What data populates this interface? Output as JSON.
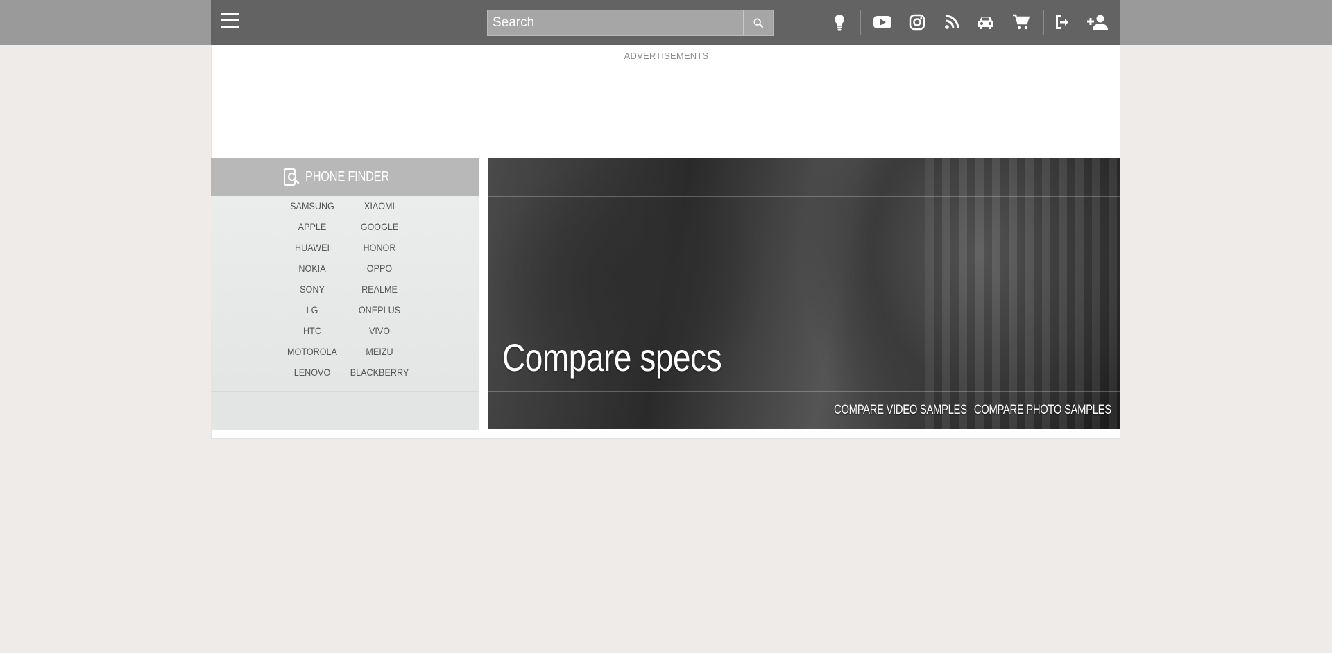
{
  "header": {
    "search_placeholder": "Search",
    "icons": [
      "menu-icon",
      "search-icon",
      "lightbulb-icon",
      "youtube-icon",
      "instagram-icon",
      "rss-icon",
      "car-icon",
      "cart-icon",
      "login-icon",
      "add-user-icon"
    ]
  },
  "ads": {
    "label": "ADVERTISEMENTS"
  },
  "finder": {
    "title": "PHONE FINDER",
    "brands_left": [
      "SAMSUNG",
      "APPLE",
      "HUAWEI",
      "NOKIA",
      "SONY",
      "LG",
      "HTC",
      "MOTOROLA",
      "LENOVO"
    ],
    "brands_right": [
      "XIAOMI",
      "GOOGLE",
      "HONOR",
      "OPPO",
      "REALME",
      "ONEPLUS",
      "VIVO",
      "MEIZU",
      "BLACKBERRY"
    ]
  },
  "hero": {
    "title": "Compare specs",
    "links": [
      "COMPARE VIDEO SAMPLES",
      "COMPARE PHOTO SAMPLES"
    ]
  },
  "colors": {
    "topbar": "#636363",
    "finder_header": "#b8b8b8",
    "page_bg": "#eeebe8"
  }
}
